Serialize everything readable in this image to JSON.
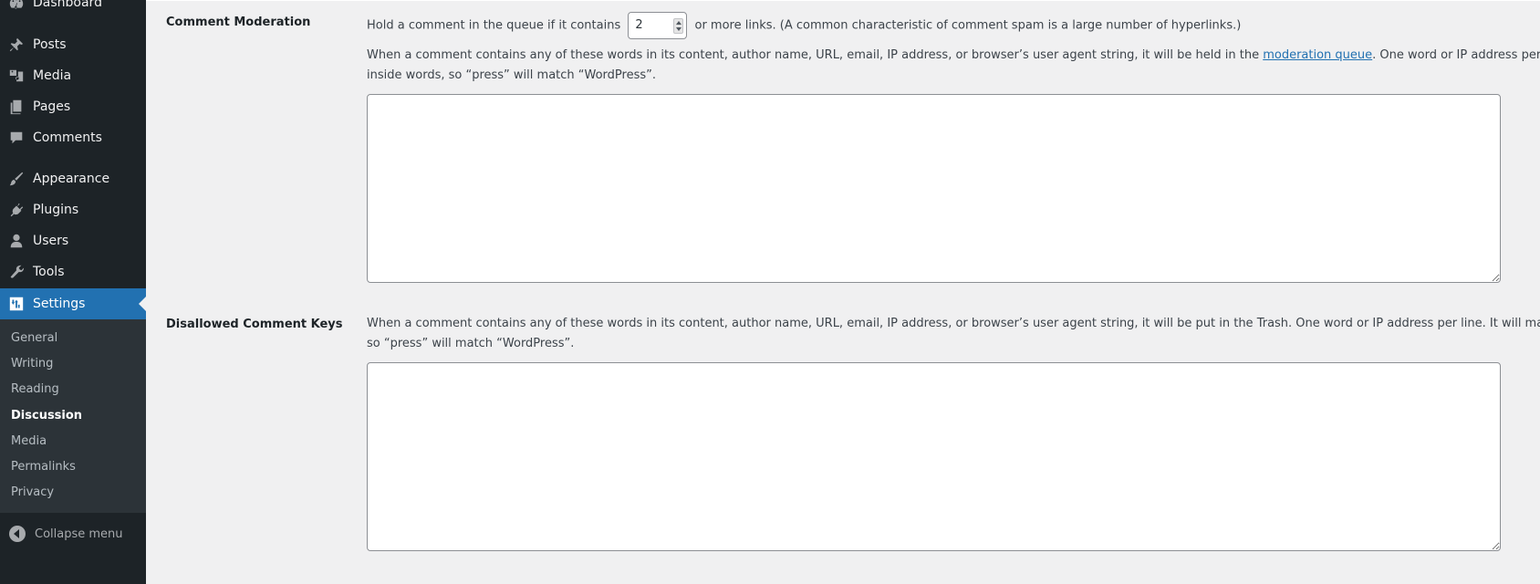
{
  "sidebar": {
    "items": [
      {
        "label": "Dashboard",
        "icon": "dashboard-icon"
      },
      {
        "label": "Posts",
        "icon": "pin-icon"
      },
      {
        "label": "Media",
        "icon": "media-icon"
      },
      {
        "label": "Pages",
        "icon": "pages-icon"
      },
      {
        "label": "Comments",
        "icon": "comment-icon"
      },
      {
        "label": "Appearance",
        "icon": "paintbrush-icon"
      },
      {
        "label": "Plugins",
        "icon": "plug-icon"
      },
      {
        "label": "Users",
        "icon": "user-icon"
      },
      {
        "label": "Tools",
        "icon": "wrench-icon"
      },
      {
        "label": "Settings",
        "icon": "settings-icon",
        "current": true
      }
    ],
    "submenu": [
      {
        "label": "General"
      },
      {
        "label": "Writing"
      },
      {
        "label": "Reading"
      },
      {
        "label": "Discussion",
        "current": true
      },
      {
        "label": "Media"
      },
      {
        "label": "Permalinks"
      },
      {
        "label": "Privacy"
      }
    ],
    "collapse_label": "Collapse menu"
  },
  "comment_moderation": {
    "label": "Comment Moderation",
    "links_prefix": "Hold a comment in the queue if it contains",
    "links_value": "2",
    "links_suffix": "or more links. (A common characteristic of comment spam is a large number of hyperlinks.)",
    "desc_before_link": "When a comment contains any of these words in its content, author name, URL, email, IP address, or browser’s user agent string, it will be held in the ",
    "desc_link": "moderation queue",
    "desc_after_link": ". One word or IP address per line. It will match inside words, so “press” will match “WordPress”.",
    "textarea_value": ""
  },
  "disallowed_keys": {
    "label": "Disallowed Comment Keys",
    "description": "When a comment contains any of these words in its content, author name, URL, email, IP address, or browser’s user agent string, it will be put in the Trash. One word or IP address per line. It will match inside words, so “press” will match “WordPress”.",
    "textarea_value": ""
  },
  "colors": {
    "sidebar_bg": "#1d2327",
    "submenu_bg": "#2c3338",
    "accent": "#2271b1",
    "page_bg": "#f0f0f1"
  }
}
